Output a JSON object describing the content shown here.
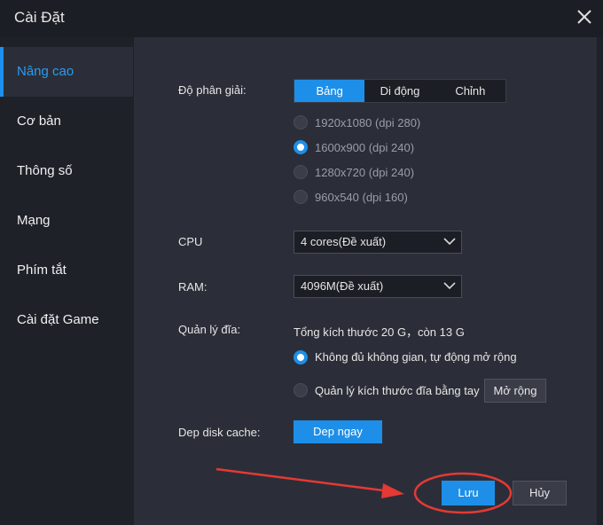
{
  "window": {
    "title": "Cài Đặt"
  },
  "sidebar": {
    "items": [
      {
        "label": "Nâng cao"
      },
      {
        "label": "Cơ bản"
      },
      {
        "label": "Thông số"
      },
      {
        "label": "Mạng"
      },
      {
        "label": "Phím tắt"
      },
      {
        "label": "Cài đặt Game"
      }
    ]
  },
  "resolution": {
    "label": "Độ phân giải:",
    "tabs": [
      "Bảng",
      "Di động",
      "Chỉnh"
    ],
    "options": [
      "1920x1080  (dpi 280)",
      "1600x900  (dpi 240)",
      "1280x720  (dpi 240)",
      "960x540  (dpi 160)"
    ],
    "selected_index": 1
  },
  "cpu": {
    "label": "CPU",
    "value": "4 cores(Đề xuất)"
  },
  "ram": {
    "label": "RAM:",
    "value": "4096M(Đề xuất)"
  },
  "disk": {
    "label": "Quản lý đĩa:",
    "summary": "Tổng kích thước 20 G，còn  13 G",
    "auto_label": "Không đủ không gian, tự động mở rộng",
    "manual_label": "Quản lý kích thước đĩa bằng tay",
    "expand_button": "Mở rộng"
  },
  "cache": {
    "label": "Dep disk cache:",
    "button": "Dep ngay"
  },
  "footer": {
    "save": "Lưu",
    "cancel": "Hủy"
  },
  "colors": {
    "accent": "#1e8fe8",
    "annotation": "#e53935"
  }
}
